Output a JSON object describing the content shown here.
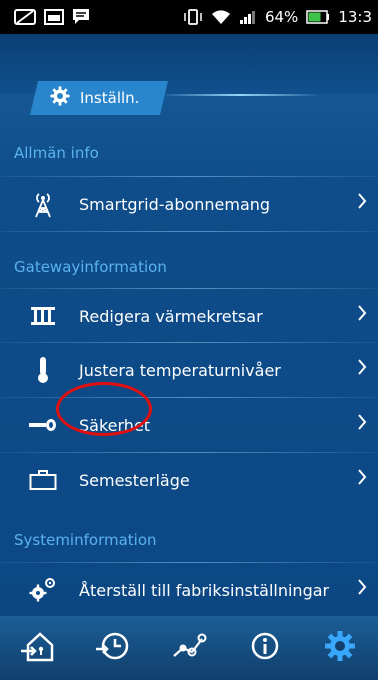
{
  "status_bar": {
    "battery_percent": "64%",
    "time": "13:3"
  },
  "tab": {
    "label": "Inställn."
  },
  "sections": {
    "general": "Allmän info",
    "gateway": "Gatewayinformation",
    "system": "Systeminformation"
  },
  "items": {
    "smartgrid": "Smartgrid-abonnemang",
    "heating_circuits": "Redigera värmekretsar",
    "temperature_levels": "Justera temperaturnivåer",
    "security": "Säkerhet",
    "vacation": "Semesterläge",
    "factory_reset": "Återställ till fabriksinställningar"
  },
  "colors": {
    "section_header": "#5ab2ef",
    "tab_background": "#2a86cc",
    "highlight_circle": "#e01010",
    "active_nav": "#38a8ff"
  },
  "nav_icons": [
    "home-icon",
    "history-icon",
    "graph-icon",
    "info-icon",
    "settings-icon"
  ]
}
